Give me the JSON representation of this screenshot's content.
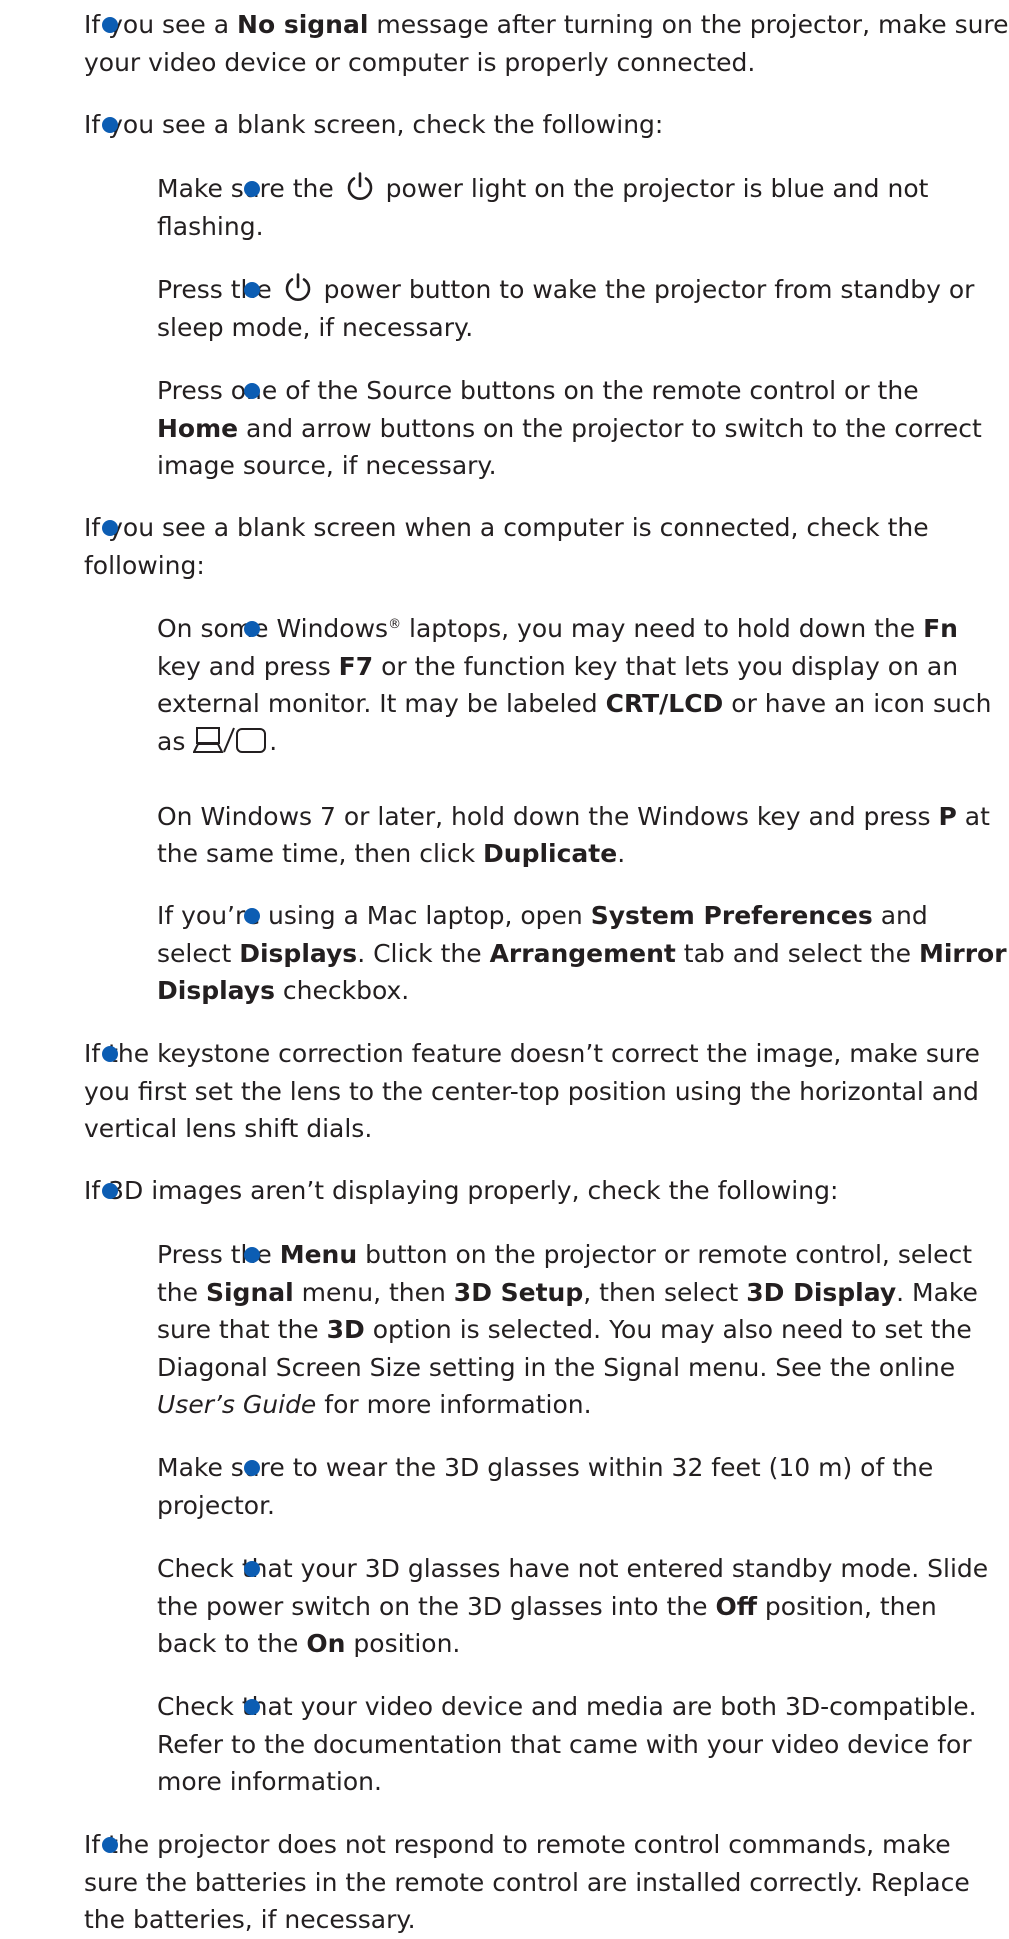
{
  "items": [
    {
      "lines": [
        [
          "If you see a ",
          {
            "b": "No signal"
          },
          " message after turning on the projector, make sure"
        ],
        [
          "your video device or computer is properly connected."
        ]
      ]
    },
    {
      "lines": [
        [
          "If you see a blank screen, check the following:"
        ]
      ]
    },
    {
      "lines": [
        [
          "Make sure the ",
          {
            "icon": "power"
          },
          " power light on the projector is blue and not"
        ],
        [
          "flashing."
        ]
      ]
    },
    {
      "lines": [
        [
          "Press the ",
          {
            "icon": "power"
          },
          " power button to wake the projector from standby or"
        ],
        [
          "sleep mode, if necessary."
        ]
      ]
    },
    {
      "lines": [
        [
          "Press one of the Source buttons on the remote control or the"
        ],
        [
          {
            "b": "Home"
          },
          " and arrow buttons on the projector to switch to the correct"
        ],
        [
          "image source, if necessary."
        ]
      ]
    },
    {
      "lines": [
        [
          "If you see a blank screen when a computer is connected, check the"
        ],
        [
          "following:"
        ]
      ]
    },
    {
      "lines": [
        [
          "On some Windows",
          {
            "sup": "®"
          },
          " laptops, you may need to hold down the ",
          {
            "b": "Fn"
          }
        ],
        [
          "key and press ",
          {
            "b": "F7"
          },
          " or the function key that lets you display on an"
        ],
        [
          "external monitor. It may be labeled ",
          {
            "b": "CRT/LCD"
          },
          " or have an icon such"
        ],
        [
          "as ",
          {
            "icon": "laptop-monitor"
          },
          "."
        ],
        [],
        [
          "On Windows 7 or later, hold down the Windows key and press ",
          {
            "b": "P"
          },
          " at"
        ],
        [
          "the same time, then click ",
          {
            "b": "Duplicate"
          },
          "."
        ]
      ]
    },
    {
      "lines": [
        [
          "If you’re using a Mac laptop, open ",
          {
            "b": "System Preferences"
          },
          " and"
        ],
        [
          "select ",
          {
            "b": "Displays"
          },
          ". Click the ",
          {
            "b": "Arrangement"
          },
          " tab and select the ",
          {
            "b": "Mirror"
          }
        ],
        [
          {
            "b": "Displays"
          },
          " checkbox."
        ]
      ]
    },
    {
      "lines": [
        [
          "If the keystone correction feature doesn’t correct the image, make sure"
        ],
        [
          "you first set the lens to the center-top position using the horizontal and"
        ],
        [
          "vertical lens shift dials."
        ]
      ]
    },
    {
      "lines": [
        [
          "If 3D images aren’t displaying properly, check the following:"
        ]
      ]
    },
    {
      "lines": [
        [
          "Press the ",
          {
            "b": "Menu"
          },
          " button on the projector or remote control, select"
        ],
        [
          "the ",
          {
            "b": "Signal"
          },
          " menu, then ",
          {
            "b": "3D Setup"
          },
          ", then select ",
          {
            "b": "3D Display"
          },
          ". Make"
        ],
        [
          "sure that the ",
          {
            "b": "3D"
          },
          " option is selected. You may also need to set the"
        ],
        [
          "Diagonal Screen Size setting in the Signal menu. See the online"
        ],
        [
          {
            "i": "User’s Guide"
          },
          " for more information."
        ]
      ]
    },
    {
      "lines": [
        [
          "Make sure to wear the 3D glasses within 32 feet (10 m) of the"
        ],
        [
          "projector."
        ]
      ]
    },
    {
      "lines": [
        [
          "Check that your 3D glasses have not entered standby mode. Slide"
        ],
        [
          "the power switch on the 3D glasses into the ",
          {
            "b": "Off"
          },
          " position, then"
        ],
        [
          "back to the ",
          {
            "b": "On"
          },
          " position."
        ]
      ]
    },
    {
      "lines": [
        [
          "Check that your video device and media are both 3D-compatible."
        ],
        [
          "Refer to the documentation that came with your video device for"
        ],
        [
          "more information."
        ]
      ]
    },
    {
      "lines": [
        [
          "If the projector does not respond to remote control commands, make"
        ],
        [
          "sure the batteries in the remote control are installed correctly. Replace"
        ],
        [
          "the batteries, if necessary."
        ]
      ]
    }
  ],
  "colors": {
    "bullet": "#0c5db3",
    "text": "#231f20"
  }
}
